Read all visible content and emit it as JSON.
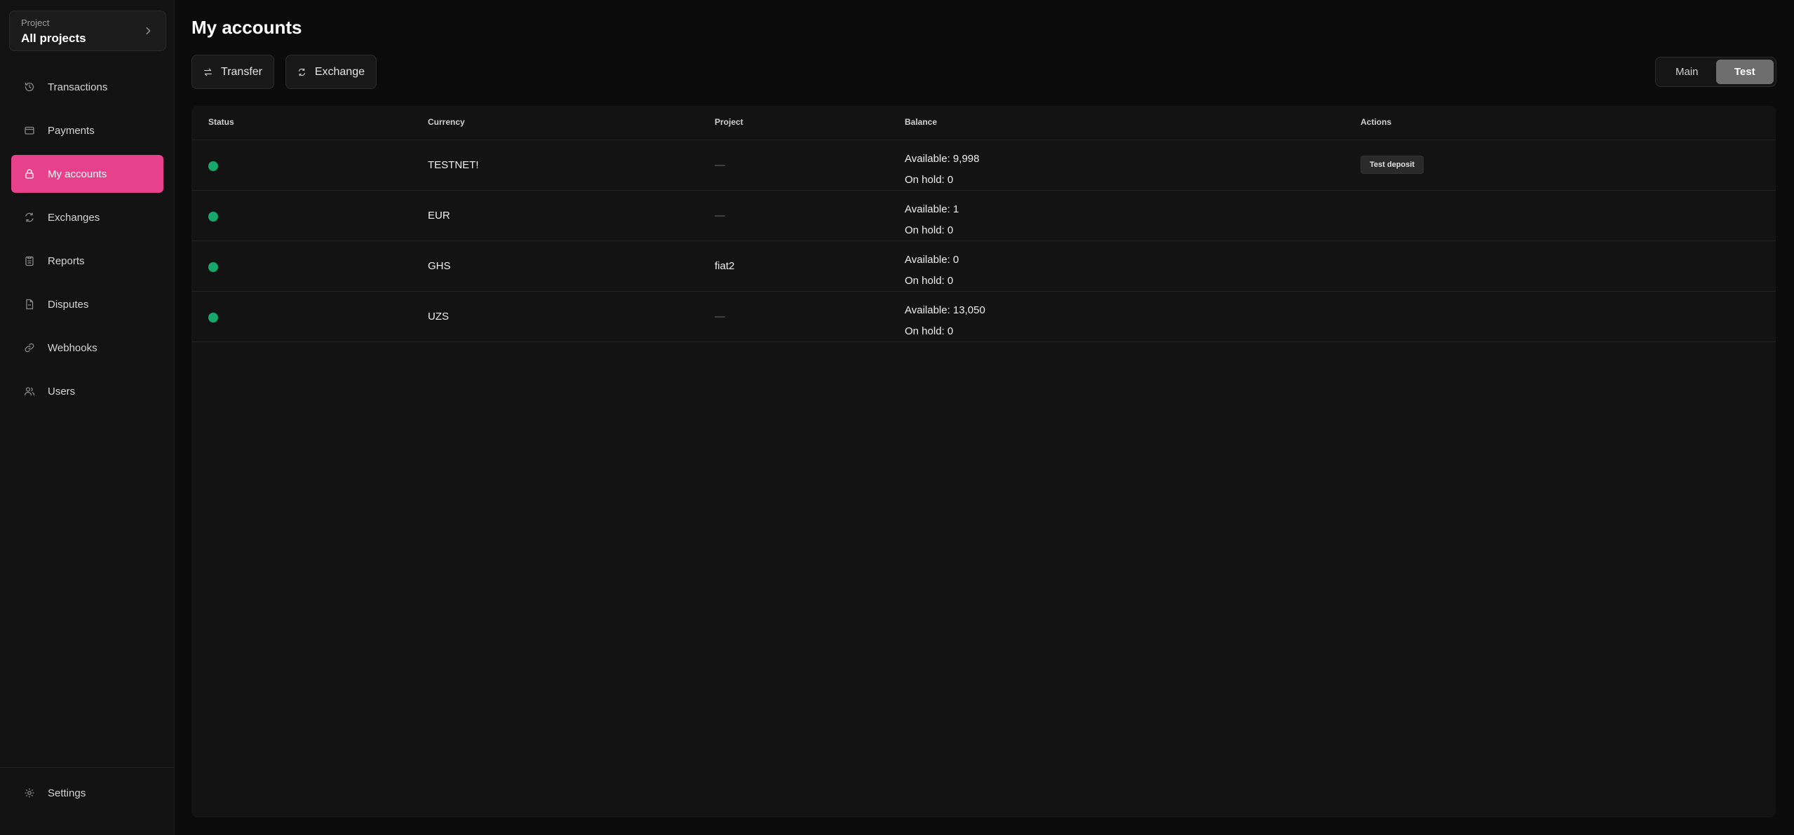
{
  "sidebar": {
    "project": {
      "label": "Project",
      "value": "All projects"
    },
    "items": [
      {
        "label": "Transactions",
        "icon": "history-icon"
      },
      {
        "label": "Payments",
        "icon": "wallet-icon"
      },
      {
        "label": "My accounts",
        "icon": "lock-icon",
        "active": true
      },
      {
        "label": "Exchanges",
        "icon": "refresh-icon"
      },
      {
        "label": "Reports",
        "icon": "clipboard-icon"
      },
      {
        "label": "Disputes",
        "icon": "file-icon"
      },
      {
        "label": "Webhooks",
        "icon": "link-icon"
      },
      {
        "label": "Users",
        "icon": "users-icon"
      }
    ],
    "settings": {
      "label": "Settings",
      "icon": "gear-icon"
    }
  },
  "page": {
    "title": "My accounts"
  },
  "toolbar": {
    "transfer_label": "Transfer",
    "exchange_label": "Exchange"
  },
  "env_toggle": {
    "options": [
      "Main",
      "Test"
    ],
    "selected": "Test"
  },
  "table": {
    "headers": {
      "status": "Status",
      "currency": "Currency",
      "project": "Project",
      "balance": "Balance",
      "actions": "Actions"
    },
    "rows": [
      {
        "status": "active",
        "currency": "TESTNET!",
        "project": "—",
        "available": "Available: 9,998",
        "on_hold": "On hold: 0",
        "action": "Test deposit"
      },
      {
        "status": "active",
        "currency": "EUR",
        "project": "—",
        "available": "Available: 1",
        "on_hold": "On hold: 0",
        "action": ""
      },
      {
        "status": "active",
        "currency": "GHS",
        "project": "fiat2",
        "available": "Available: 0",
        "on_hold": "On hold: 0",
        "action": ""
      },
      {
        "status": "active",
        "currency": "UZS",
        "project": "—",
        "available": "Available: 13,050",
        "on_hold": "On hold: 0",
        "action": ""
      }
    ]
  },
  "colors": {
    "accent": "#e8418b",
    "status_active": "#17a96b",
    "background": "#0b0b0b"
  }
}
